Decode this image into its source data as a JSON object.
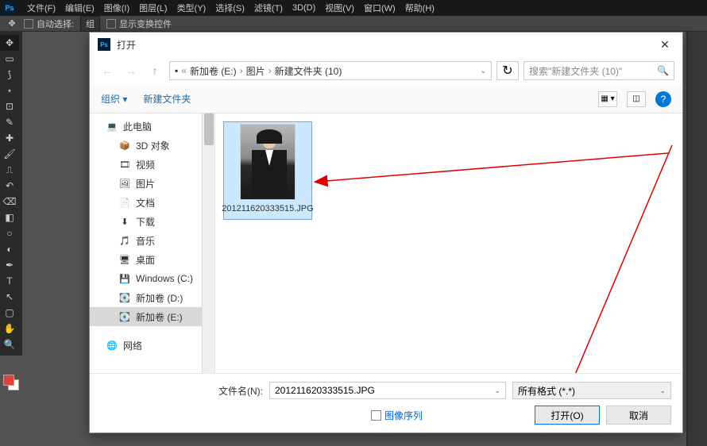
{
  "ps": {
    "menu": [
      "文件(F)",
      "编辑(E)",
      "图像(I)",
      "图层(L)",
      "类型(Y)",
      "选择(S)",
      "滤镜(T)",
      "3D(D)",
      "视图(V)",
      "窗口(W)",
      "帮助(H)"
    ],
    "toolbar_label": "自动选择:",
    "toolbar_group": "组",
    "toolbar_transform": "显示变换控件"
  },
  "dialog": {
    "title": "打开",
    "path_parts": [
      "新加卷 (E:)",
      "图片",
      "新建文件夹 (10)"
    ],
    "search_placeholder": "搜索\"新建文件夹 (10)\"",
    "toolbar": {
      "organize": "组织",
      "new_folder": "新建文件夹"
    },
    "tree": [
      {
        "icon": "💻",
        "label": "此电脑",
        "level": 1
      },
      {
        "icon": "📦",
        "label": "3D 对象",
        "level": 2
      },
      {
        "icon": "🎞",
        "label": "视频",
        "level": 2
      },
      {
        "icon": "🖼",
        "label": "图片",
        "level": 2
      },
      {
        "icon": "📄",
        "label": "文档",
        "level": 2
      },
      {
        "icon": "⬇",
        "label": "下载",
        "level": 2
      },
      {
        "icon": "🎵",
        "label": "音乐",
        "level": 2
      },
      {
        "icon": "🖥",
        "label": "桌面",
        "level": 2
      },
      {
        "icon": "💾",
        "label": "Windows (C:)",
        "level": 2
      },
      {
        "icon": "💽",
        "label": "新加卷 (D:)",
        "level": 2
      },
      {
        "icon": "💽",
        "label": "新加卷 (E:)",
        "level": 2,
        "active": true
      },
      {
        "icon": "🌐",
        "label": "网络",
        "level": 1
      }
    ],
    "files": [
      {
        "name": "201211620333515.JPG"
      }
    ],
    "footer": {
      "filename_label": "文件名(N):",
      "filename_value": "201211620333515.JPG",
      "filetype_value": "所有格式 (*.*)",
      "sequence_label": "图像序列",
      "open_btn": "打开(O)",
      "cancel_btn": "取消"
    }
  }
}
